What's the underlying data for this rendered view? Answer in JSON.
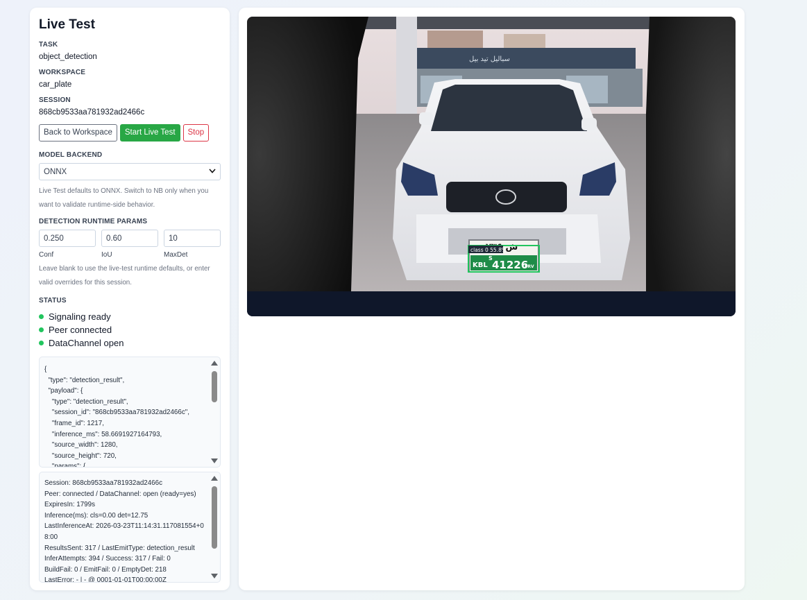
{
  "page": {
    "title": "Live Test"
  },
  "info": {
    "task_label": "TASK",
    "task_value": "object_detection",
    "workspace_label": "WORKSPACE",
    "workspace_value": "car_plate",
    "session_label": "SESSION",
    "session_value": "868cb9533aa781932ad2466c"
  },
  "buttons": {
    "back": "Back to Workspace",
    "start": "Start Live Test",
    "stop": "Stop"
  },
  "model": {
    "label": "MODEL BACKEND",
    "selected": "ONNX",
    "hint": "Live Test defaults to ONNX. Switch to NB only when you want to validate runtime-side behavior."
  },
  "params": {
    "label": "DETECTION RUNTIME PARAMS",
    "conf_value": "0.250",
    "iou_value": "0.60",
    "maxdet_value": "10",
    "conf_label": "Conf",
    "iou_label": "IoU",
    "maxdet_label": "MaxDet",
    "hint": "Leave blank to use the live-test runtime defaults, or enter valid overrides for this session."
  },
  "status": {
    "label": "STATUS",
    "items": [
      "Signaling ready",
      "Peer connected",
      "DataChannel open"
    ],
    "color": "#22c55e"
  },
  "json_log": "{\n  \"type\": \"detection_result\",\n  \"payload\": {\n    \"type\": \"detection_result\",\n    \"session_id\": \"868cb9533aa781932ad2466c\",\n    \"frame_id\": 1217,\n    \"inference_ms\": 58.6691927164793,\n    \"source_width\": 1280,\n    \"source_height\": 720,\n    \"params\": {",
  "stats_log": "Session: 868cb9533aa781932ad2466c\nPeer: connected / DataChannel: open (ready=yes)\nExpiresIn: 1799s\nInference(ms): cls=0.00 det=12.75\nLastInferenceAt: 2026-03-23T11:14:31.117081554+08:00\nResultsSent: 317 / LastEmitType: detection_result\nInferAttempts: 394 / Success: 317 / Fail: 0\nBuildFail: 0 / EmitFail: 0 / EmptyDet: 218\nLastError: - | - @ 0001-01-01T00:00:00Z",
  "video": {
    "plate_left": "KBL",
    "plate_number": "41226",
    "plate_mark": "S",
    "plate_suffix": "PRV",
    "plate_script": "ش ۲۳۶",
    "detection_label": "class 0 55.8%",
    "sign_text": "سبالیل تید بیل",
    "car_logo": "TOYOTA"
  },
  "colors": {
    "accent_green": "#28a745",
    "stop_red": "#dc3545"
  }
}
